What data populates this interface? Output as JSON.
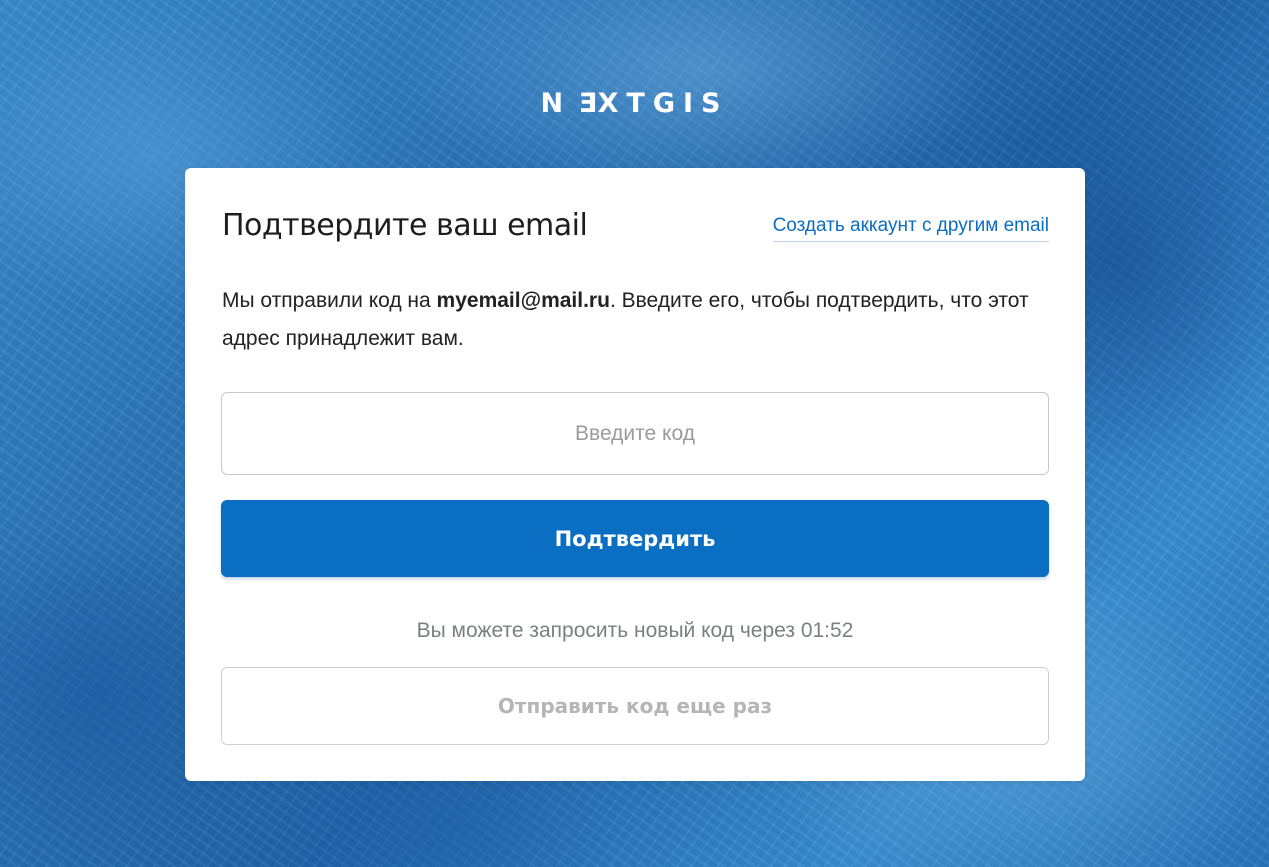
{
  "brand": {
    "logo_before": "N",
    "logo_mirrored": "E",
    "logo_after": "XTGIS"
  },
  "card": {
    "title": "Подтвердите ваш email",
    "alt_link": "Создать аккаунт с другим email",
    "message_prefix": "Мы отправили код на ",
    "email": "myemail@mail.ru",
    "message_suffix": ". Введите его, чтобы подтвердить, что этот адрес принадлежит вам.",
    "code_input": {
      "placeholder": "Введите код",
      "value": ""
    },
    "confirm_label": "Подтвердить",
    "resend_hint_prefix": "Вы можете запросить новый код через ",
    "resend_timer": "01:52",
    "resend_label": "Отправить код еще раз"
  },
  "colors": {
    "primary": "#0a6fc2",
    "link": "#0b6dc1",
    "background": "#2a78bd",
    "muted_text": "#7b7f84",
    "disabled_text": "#b5b5b5"
  }
}
